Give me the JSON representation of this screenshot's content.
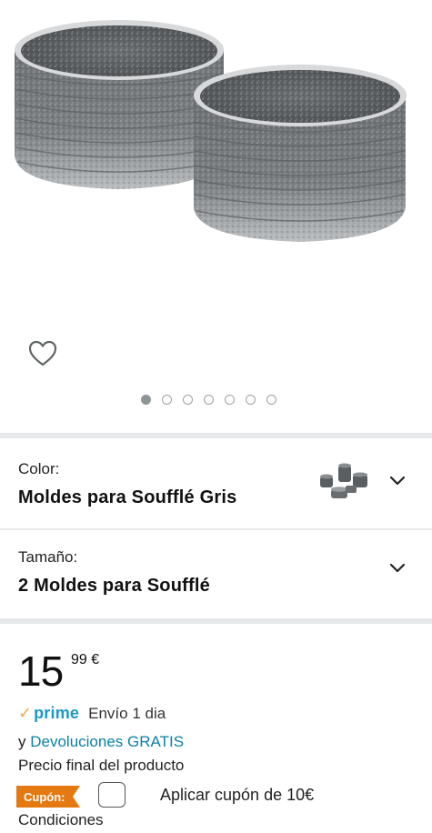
{
  "product": {
    "image_alt": "ramekin-bowls-photo",
    "gallery_dot_count": 7,
    "gallery_active_index": 0,
    "wishlist_icon": "heart-outline-icon"
  },
  "variations": {
    "color_label": "Color:",
    "color_value": "Moldes para Soufflé Gris",
    "size_label": "Tamaño:",
    "size_value": "2 Moldes para Soufflé"
  },
  "pricing": {
    "whole": "15",
    "fraction": "99 €",
    "prime_check": "✓",
    "prime_label": "prime",
    "delivery": "Envío 1 dia",
    "returns_prefix": "y ",
    "returns_link": "Devoluciones GRATIS",
    "final_price_note": "Precio final del producto"
  },
  "coupon": {
    "badge": "Cupón:",
    "apply_text": "Aplicar cupón de 10€",
    "conditions_link": "Condiciones"
  },
  "colors": {
    "prime_blue": "#1a98c9",
    "link_blue": "#0a7fa8",
    "prime_check_orange": "#f3a847",
    "coupon_orange": "#e47911",
    "divider": "#e6e9ea"
  }
}
